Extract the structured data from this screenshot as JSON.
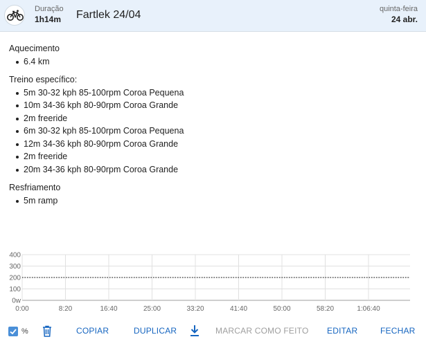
{
  "header": {
    "icon": "bicycle-icon",
    "duration_label": "Duração",
    "duration_value": "1h14m",
    "title": "Fartlek 24/04",
    "day": "quinta-feira",
    "date": "24 abr."
  },
  "sections": [
    {
      "title": "Aquecimento",
      "items": [
        "6.4 km"
      ]
    },
    {
      "title": "Treino específico:",
      "items": [
        "5m 30-32 kph 85-100rpm Coroa Pequena",
        "10m 34-36 kph 80-90rpm Coroa Grande",
        "2m freeride",
        "6m 30-32 kph 85-100rpm Coroa Pequena",
        "12m 34-36 kph 80-90rpm Coroa Grande",
        "2m freeride",
        "20m 34-36 kph 80-90rpm Coroa Grande"
      ]
    },
    {
      "title": "Resfriamento",
      "items": [
        "5m ramp"
      ]
    }
  ],
  "chart_data": {
    "type": "line",
    "y_ticks": [
      "400",
      "300",
      "200",
      "100",
      "0w"
    ],
    "ylim": [
      0,
      400
    ],
    "x_ticks": [
      "0:00",
      "8:20",
      "16:40",
      "25:00",
      "33:20",
      "41:40",
      "50:00",
      "58:20",
      "1:06:40"
    ],
    "reference_line": {
      "value": 200,
      "style": "dotted"
    },
    "grid": true
  },
  "toolbar": {
    "percent_checked": true,
    "percent_label": "%",
    "copy_label": "COPIAR",
    "duplicate_label": "DUPLICAR",
    "mark_done_label": "MARCAR COMO FEITO",
    "edit_label": "EDITAR",
    "close_label": "FECHAR",
    "accent_color": "#1565c0",
    "disabled_color": "#9e9e9e"
  }
}
